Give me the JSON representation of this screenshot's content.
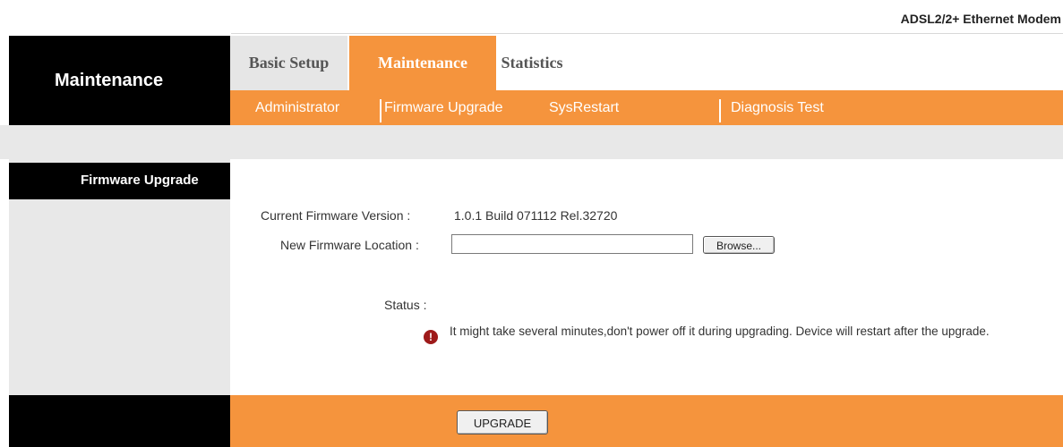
{
  "header": {
    "model": "ADSL2/2+ Ethernet Modem"
  },
  "left": {
    "title": "Maintenance",
    "section": "Firmware Upgrade"
  },
  "tabs": {
    "main": [
      {
        "label": "Basic Setup",
        "active": false
      },
      {
        "label": "Maintenance",
        "active": true
      },
      {
        "label": "Statistics",
        "active": false
      }
    ],
    "sub": [
      {
        "label": "Administrator",
        "active": false
      },
      {
        "label": "Firmware Upgrade",
        "active": true
      },
      {
        "label": "SysRestart",
        "active": false
      },
      {
        "label": "Diagnosis Test",
        "active": false
      }
    ]
  },
  "form": {
    "current_label": "Current Firmware Version :",
    "current_value": "1.0.1 Build 071112 Rel.32720",
    "new_label": "New Firmware Location :",
    "file_value": "",
    "browse_label": "Browse...",
    "status_label": "Status :",
    "warning_text": "It might take several minutes,don't power off it during upgrading. Device will restart after the upgrade.",
    "upgrade_label": "UPGRADE"
  },
  "colors": {
    "accent": "#f5943d",
    "dark": "#000000",
    "panel": "#e8e8e8",
    "warn": "#9e1a1a"
  },
  "icons": {
    "warning": "exclamation-circle-icon"
  }
}
